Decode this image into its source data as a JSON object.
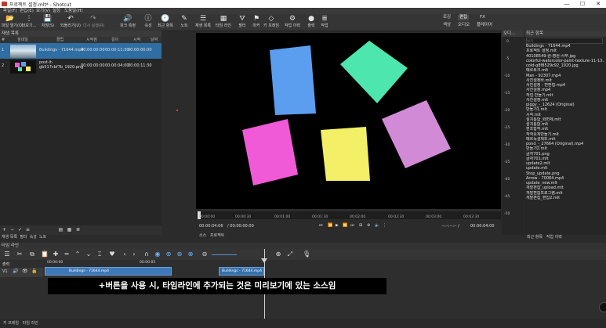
{
  "window": {
    "title": "프로젝트 설정.mlt* - Shotcut",
    "minimize": "—",
    "maximize": "☐",
    "close": "✕"
  },
  "menu": [
    "파일(F)",
    "편집(E)",
    "보기(V)",
    "설정",
    "도움말(H)"
  ],
  "toolbar": {
    "items": [
      {
        "icon": "folder-open-icon",
        "glyph": "📂",
        "label": "파일 열기(O)"
      },
      {
        "icon": "more-icon",
        "glyph": "⋮",
        "label": "더보기..."
      },
      {
        "icon": "save-icon",
        "glyph": "💾",
        "label": "저장(S)"
      },
      {
        "icon": "undo-icon",
        "glyph": "↶",
        "label": "되돌리기(U)"
      },
      {
        "icon": "redo-icon",
        "glyph": "↷",
        "label": "다시 실행(R)"
      },
      {
        "icon": "peak-meter-icon",
        "glyph": "🔊",
        "label": "피크 측정"
      },
      {
        "icon": "properties-icon",
        "glyph": "ⓘ",
        "label": "속성"
      },
      {
        "icon": "recent-icon",
        "glyph": "🕘",
        "label": "최근 항목"
      },
      {
        "icon": "notes-icon",
        "glyph": "✎",
        "label": "노트"
      },
      {
        "icon": "playlist-icon",
        "glyph": "☰",
        "label": "재생 목록"
      },
      {
        "icon": "timeline-icon",
        "glyph": "▦",
        "label": "타임 라인"
      },
      {
        "icon": "filter-icon",
        "glyph": "⛛",
        "label": "필터"
      },
      {
        "icon": "marker-icon",
        "glyph": "⚑",
        "label": "마커"
      },
      {
        "icon": "keyframe-icon",
        "glyph": "◇",
        "label": "키 프레임"
      },
      {
        "icon": "jobs-icon",
        "glyph": "⚙",
        "label": "작업 이력"
      },
      {
        "icon": "export-icon",
        "glyph": "●",
        "label": "출력"
      },
      {
        "icon": "job-icon",
        "glyph": "≣",
        "label": "작업"
      }
    ],
    "workspaces_top": [
      "로깅",
      "편집",
      "FX"
    ],
    "workspaces_bottom": [
      "색상",
      "오디오",
      "플레이어"
    ],
    "active_workspace": "편집"
  },
  "playlist": {
    "title": "재생 목록",
    "columns": [
      "#",
      "섬네일",
      "클립",
      "시작점",
      "길이",
      "시작",
      "날짜"
    ],
    "rows": [
      {
        "index": "1",
        "clip": "Buildings - 71644.mp4",
        "in": "00:00:00:00",
        "duration": "00:00:11:30",
        "start": "00:00:00:00",
        "selected": true
      },
      {
        "index": "2",
        "clip": "post-it-gb517cbf7b_1920.png",
        "in": "00:00:00:00",
        "duration": "00:00:04:00",
        "start": "00:00:11:30",
        "selected": false
      }
    ],
    "bottom_buttons": [
      "+",
      "−",
      "✓",
      "≡",
      "▤",
      "▦",
      "≣"
    ],
    "tabs": [
      "재생 목록",
      "필터",
      "속성",
      "노트"
    ]
  },
  "player": {
    "ruler_labels": [
      "00:00:00",
      "00:00:30",
      "00:01:00",
      "00:01:30",
      "00:02:00",
      "00:02:30",
      "00:03:00",
      "00:03:30"
    ],
    "timecode": "00:00:04:06",
    "duration": "/ 00:00:00:00",
    "in_out": "--:--:--:-- /",
    "end_time": "00:00:04:00",
    "tabs": [
      "소스",
      "프로젝트"
    ]
  },
  "meter": {
    "header": "오디...",
    "scale": [
      "0",
      "-5",
      "-10",
      "-15",
      "-20",
      "-25",
      "-30",
      "-35",
      "-40",
      "-45",
      "-50"
    ]
  },
  "recent": {
    "title": "최근 항목",
    "search_placeholder": "보기",
    "items": [
      "Buildings - 71644.mp4",
      "프로젝트 설정.mlt",
      "40108549-원-병원-사무.jpg",
      "colorful-watercolor-paint-texture-11-13...",
      "cold-g8f8529c92_1920.jpg",
      "메르토크.mlt",
      "Man - 92307.mp4",
      "사진설정바.mlt",
      "사진설정 - 변환법.mp4",
      "사진설정.mp4",
      "작업 만들기.mlt",
      "사진설정.mlt",
      "piggy_-_12624 (Original)",
      "만들기1.mlt",
      "시작.mlt",
      "설치통합_화면체.mlt",
      "설치통합.mlt",
      "편조합작.mlt",
      "작작요계만들기.mlt",
      "메르독결제트.mlt",
      "pond_-_27664 (Original).mp4",
      "만들기2.mlt",
      "글자701.png",
      "글자701.mlt",
      "update2.mlt",
      "update.mlt",
      "Stop_update.png",
      "Arrow - 70084.mp4",
      "update_new.mlt",
      "개발편집_upload.mlt",
      "개발편집프로그램.mlt",
      "개발편집_편집2.mlt"
    ],
    "tabs": [
      "최근 항목",
      "작업 이력"
    ]
  },
  "timeline": {
    "title": "타임 라인",
    "track_label": "출력",
    "track_name": "V1",
    "ruler": [
      "00:00:00",
      "00:00:05"
    ],
    "clip1": "Buildings - 71644.mp4",
    "clip2": "Buildings - 71644.mp4",
    "zoom": "100"
  },
  "subtitle": "+버튼을 사용 시, 타임라인에 추가되는 것은 미리보기에 있는 소스임",
  "status_tabs": [
    "키 프레임",
    "타임 라인"
  ],
  "colors": {
    "note_blue": "#5b9ef0",
    "note_green": "#4de6ae",
    "note_pink": "#f15ad6",
    "note_yellow": "#f3ef66",
    "note_lavender": "#d08ad6",
    "selection": "#2f6ea3"
  }
}
